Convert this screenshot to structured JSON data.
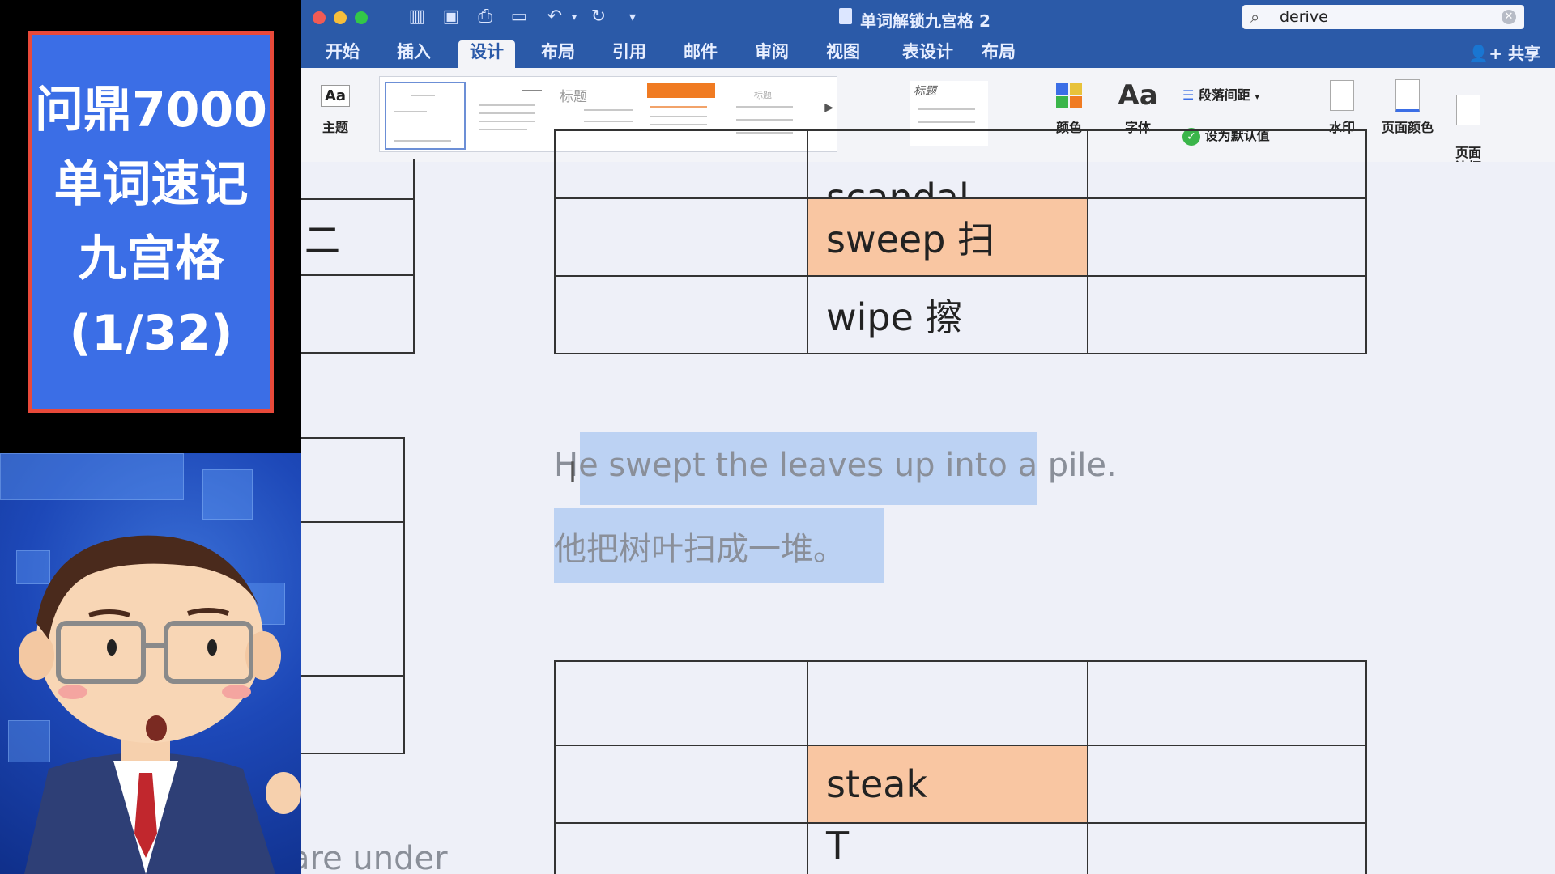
{
  "overlay": {
    "title_lines": [
      "问鼎7000",
      "单词速记",
      "九宫格",
      "(1/32)"
    ],
    "colors": {
      "card_bg": "#3b6ee6",
      "card_border": "#e8493a"
    }
  },
  "window": {
    "doc_title": "单词解锁九宫格 2",
    "search_value": "derive",
    "share_label": "共享",
    "tabs": [
      "开始",
      "插入",
      "设计",
      "布局",
      "引用",
      "邮件",
      "审阅",
      "视图",
      "表设计",
      "布局"
    ],
    "active_tab": "设计",
    "accent": "#2b5aa8"
  },
  "ribbon": {
    "theme_label": "主题",
    "theme_icon_text": "Aa",
    "gallery_labels": [
      "标题",
      "标题",
      "标题"
    ],
    "colors_label": "颜色",
    "fonts_label": "字体",
    "fonts_icon_text": "Aa",
    "paragraph_spacing_label": "段落间距",
    "set_default_label": "设为默认值",
    "watermark_label": "水印",
    "page_color_label": "页面颜色",
    "page_border_label": "页面\n边框"
  },
  "document": {
    "top_table": {
      "partial_word": "scandal",
      "rows": [
        {
          "word": "sweep  扫",
          "highlight": true
        },
        {
          "word": "wipe  擦",
          "highlight": false
        }
      ]
    },
    "left_partial_char": "二",
    "sentence_en": "He swept the leaves up into a pile.",
    "sentence_zh": "他把树叶扫成一堆。",
    "bottom_table": {
      "rows": [
        {
          "word": "",
          "highlight": false
        },
        {
          "word": "steak",
          "highlight": true
        },
        {
          "word": "T",
          "highlight": false
        }
      ]
    },
    "bottom_left_partial": "are under"
  }
}
